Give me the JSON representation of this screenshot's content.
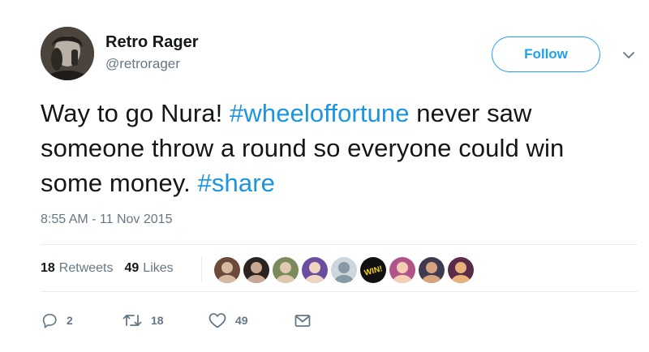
{
  "user": {
    "name": "Retro Rager",
    "handle": "@retrorager"
  },
  "follow_button": {
    "label": "Follow"
  },
  "tweet": {
    "segments": [
      {
        "text": "Way to go Nura! ",
        "hashtag": false
      },
      {
        "text": "#wheeloffortune",
        "hashtag": true
      },
      {
        "text": " never saw someone throw a round so everyone could win some money. ",
        "hashtag": false
      },
      {
        "text": "#share",
        "hashtag": true
      }
    ],
    "timestamp": "8:55 AM - 11 Nov 2015"
  },
  "stats": {
    "retweets_count": "18",
    "retweets_label": "Retweets",
    "likes_count": "49",
    "likes_label": "Likes"
  },
  "likers": [
    {
      "name": "liker-avatar-1",
      "bg": "#6b4a3a",
      "fg": "#d9b8a0"
    },
    {
      "name": "liker-avatar-2",
      "bg": "#2a2320",
      "fg": "#c9a893"
    },
    {
      "name": "liker-avatar-3",
      "bg": "#7b8a5a",
      "fg": "#e0c9b0"
    },
    {
      "name": "liker-avatar-4",
      "bg": "#6a4fa0",
      "fg": "#f0d6c0"
    },
    {
      "name": "liker-avatar-default",
      "bg": "#ccd6dd",
      "fg": "#8899a6"
    },
    {
      "name": "liker-avatar-win",
      "bg": "#111111",
      "fg": "#f2d21b"
    },
    {
      "name": "liker-avatar-7",
      "bg": "#b0558a",
      "fg": "#f4cdb2"
    },
    {
      "name": "liker-avatar-8",
      "bg": "#3e3a4f",
      "fg": "#d8a47f"
    },
    {
      "name": "liker-avatar-9",
      "bg": "#5a2c4a",
      "fg": "#e7b27a"
    }
  ],
  "win_badge_text": "WIN!",
  "actions": {
    "reply_count": "2",
    "retweet_count": "18",
    "like_count": "49"
  },
  "colors": {
    "accent": "#1da1f2",
    "hashtag": "#1b95e0",
    "text_primary": "#14171a",
    "text_secondary": "#657786",
    "divider": "#e6ecf0"
  }
}
